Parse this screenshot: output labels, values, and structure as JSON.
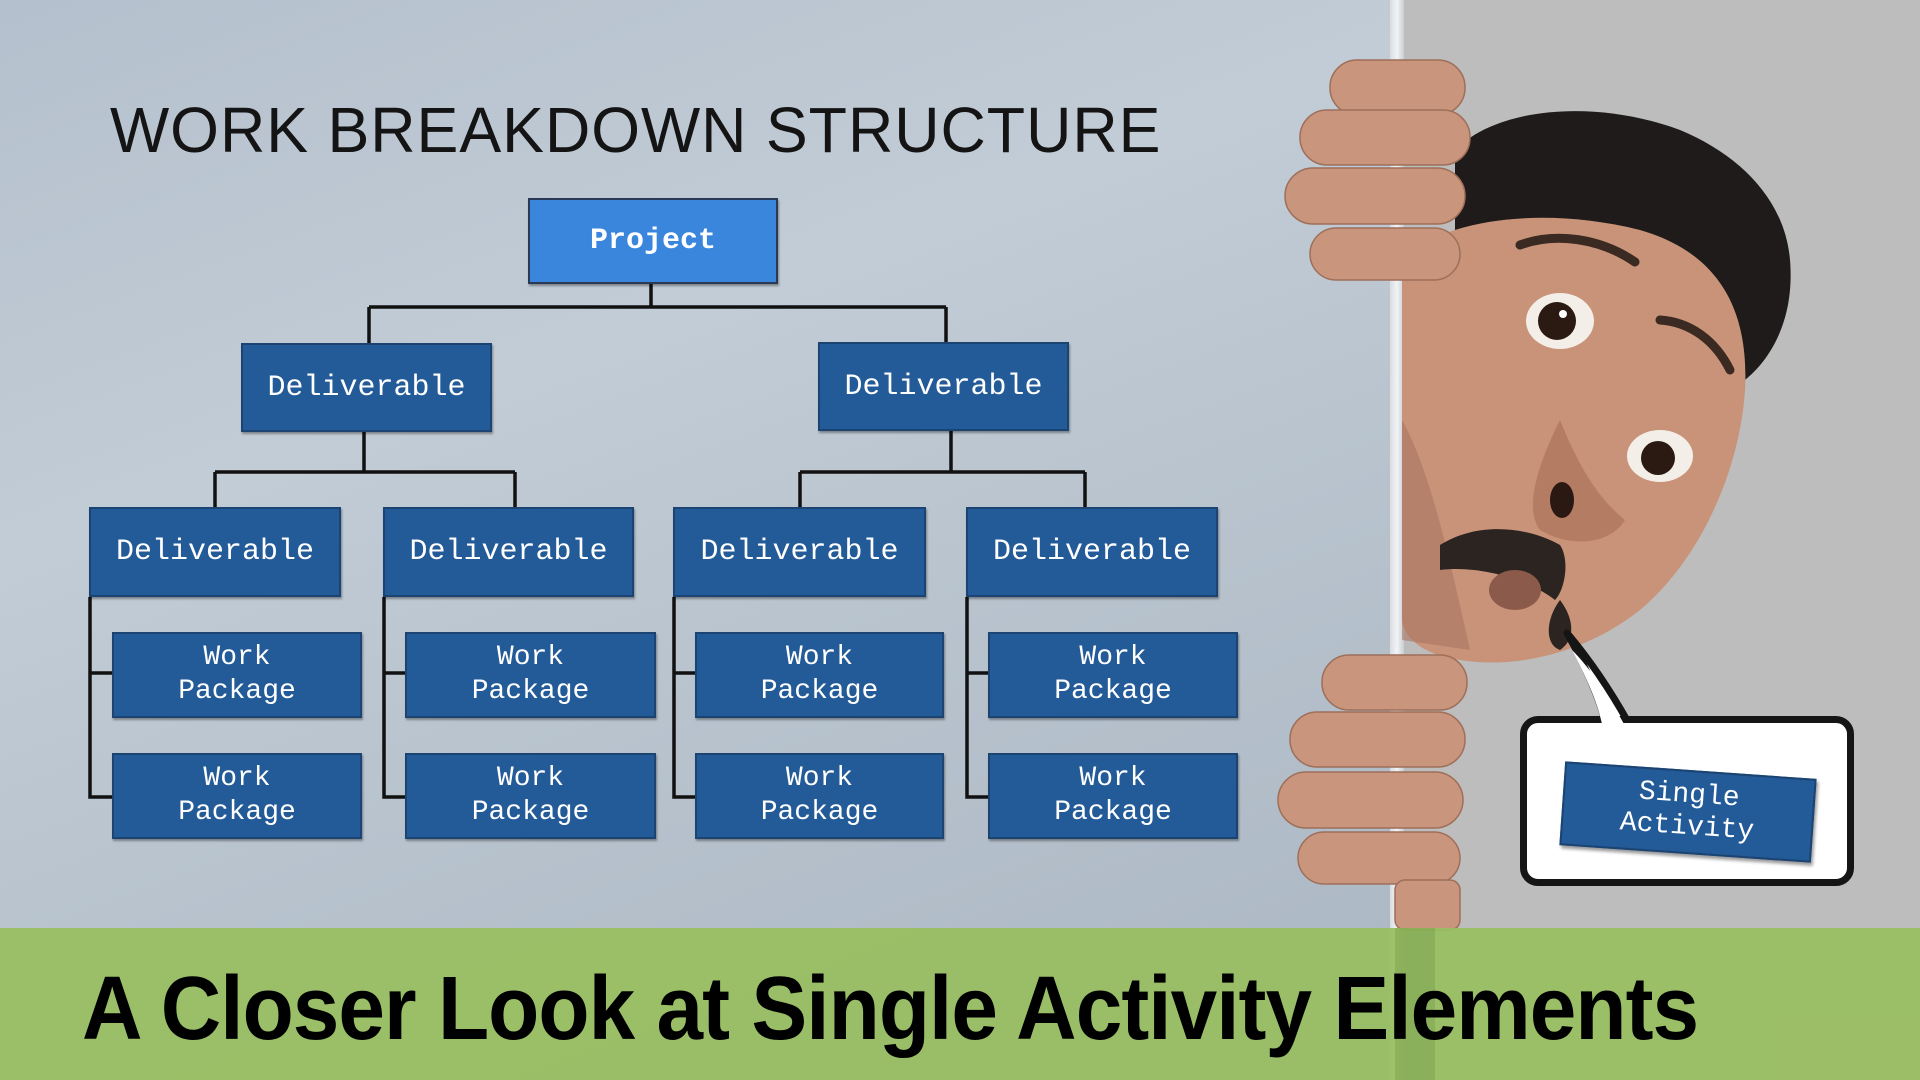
{
  "slide": {
    "diagram_title": "WORK BREAKDOWN STRUCTURE",
    "headline": "A Closer Look at Single Activity Elements"
  },
  "wbs": {
    "root": {
      "label": "Project"
    },
    "level1": [
      {
        "label": "Deliverable"
      },
      {
        "label": "Deliverable"
      }
    ],
    "level2": [
      {
        "label": "Deliverable",
        "parent": 0,
        "work_packages": [
          {
            "line1": "Work",
            "line2": "Package"
          },
          {
            "line1": "Work",
            "line2": "Package"
          }
        ]
      },
      {
        "label": "Deliverable",
        "parent": 0,
        "work_packages": [
          {
            "line1": "Work",
            "line2": "Package"
          },
          {
            "line1": "Work",
            "line2": "Package"
          }
        ]
      },
      {
        "label": "Deliverable",
        "parent": 1,
        "work_packages": [
          {
            "line1": "Work",
            "line2": "Package"
          },
          {
            "line1": "Work",
            "line2": "Package"
          }
        ]
      },
      {
        "label": "Deliverable",
        "parent": 1,
        "work_packages": [
          {
            "line1": "Work",
            "line2": "Package"
          },
          {
            "line1": "Work",
            "line2": "Package"
          }
        ]
      }
    ]
  },
  "callout": {
    "line1": "Single",
    "line2": "Activity"
  },
  "colors": {
    "root_box": "#3a86dd",
    "node_box": "#235a98",
    "band": "#9bbf63",
    "board": "#b8c3ce",
    "backdrop": "#bdbdbd"
  },
  "illustration": "surprised-man-peeking-from-behind-board"
}
